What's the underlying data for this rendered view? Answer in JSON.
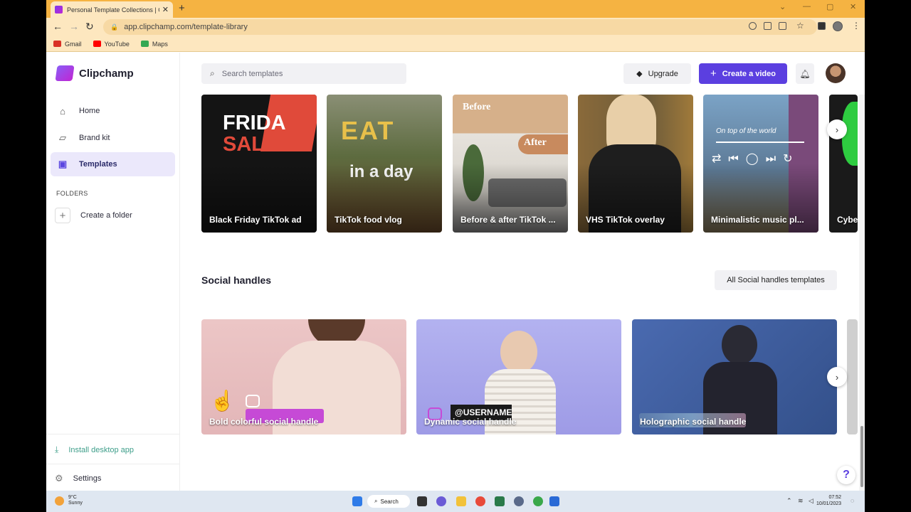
{
  "browser": {
    "tab_title": "Personal Template Collections | C",
    "url": "app.clipchamp.com/template-library",
    "bookmarks": [
      {
        "label": "Gmail",
        "color": "#d93025"
      },
      {
        "label": "YouTube",
        "color": "#ff0000"
      },
      {
        "label": "Maps",
        "color": "#34a853"
      }
    ]
  },
  "sidebar": {
    "logo": "Clipchamp",
    "items": [
      {
        "label": "Home",
        "icon": "home-icon"
      },
      {
        "label": "Brand kit",
        "icon": "brand-kit-icon"
      },
      {
        "label": "Templates",
        "icon": "templates-icon",
        "active": true
      }
    ],
    "folders_heading": "FOLDERS",
    "create_folder": "Create a folder",
    "install": "Install desktop app",
    "settings": "Settings"
  },
  "header": {
    "search_placeholder": "Search templates",
    "upgrade": "Upgrade",
    "create": "Create a video"
  },
  "row1": {
    "cards": [
      {
        "label": "Black Friday TikTok ad",
        "overlay": "BLACK FRIDAY SALE",
        "bg": "#141414",
        "accent": "#e04a3a"
      },
      {
        "label": "TikTok food vlog",
        "overlay": "WHAT I EAT in a day",
        "bg": "#5d6b3f",
        "accent": "#b43a2a"
      },
      {
        "label": "Before & after TikTok ...",
        "overlay_top": "Before",
        "overlay_mid": "After",
        "bg": "#d8d4cc",
        "accent": "#c88a5e"
      },
      {
        "label": "VHS TikTok overlay",
        "bg": "#6b5a3a",
        "accent": "#2a2a2a"
      },
      {
        "label": "Minimalistic music pl...",
        "overlay": "On top of the world",
        "bg": "#5d7a96",
        "accent": "#9a5a8a"
      },
      {
        "label": "Cybe",
        "bg": "#1a1a1a",
        "accent": "#2ecc40"
      }
    ]
  },
  "social": {
    "title": "Social handles",
    "all_button": "All Social handles templates",
    "cards": [
      {
        "label": "Bold colorful social handle",
        "bg": "#e8c4c4",
        "accent": "#8c5a44"
      },
      {
        "label": "Dynamic social handle",
        "overlay": "@USERNAME",
        "bg": "#a9a8e8",
        "accent": "#e8c9b0"
      },
      {
        "label": "Holographic social handle",
        "bg": "#3a5a9a",
        "accent": "#2a2a3a"
      }
    ]
  },
  "help": "?",
  "taskbar": {
    "weather_temp": "9°C",
    "weather_desc": "Sunny",
    "search": "Search",
    "time": "07:52",
    "date": "10/01/2023"
  }
}
